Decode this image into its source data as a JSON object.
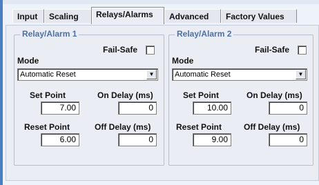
{
  "tabs": [
    "Input",
    "Scaling",
    "Relays/Alarms",
    "Advanced",
    "Factory Values"
  ],
  "active_tab": "Relays/Alarms",
  "icons": {
    "dropdown": "chevron-down-icon"
  },
  "relays": [
    {
      "title": "Relay/Alarm 1",
      "fail_safe_label": "Fail-Safe",
      "mode_label": "Mode",
      "mode_value": "Automatic Reset",
      "set_point_label": "Set Point",
      "set_point_value": "7.00",
      "on_delay_label": "On Delay (ms)",
      "on_delay_value": "0",
      "reset_point_label": "Reset Point",
      "reset_point_value": "6.00",
      "off_delay_label": "Off Delay (ms)",
      "off_delay_value": "0"
    },
    {
      "title": "Relay/Alarm 2",
      "fail_safe_label": "Fail-Safe",
      "mode_label": "Mode",
      "mode_value": "Automatic Reset",
      "set_point_label": "Set Point",
      "set_point_value": "10.00",
      "on_delay_label": "On Delay (ms)",
      "on_delay_value": "0",
      "reset_point_label": "Reset Point",
      "reset_point_value": "9.00",
      "off_delay_label": "Off Delay (ms)",
      "off_delay_value": "0"
    }
  ]
}
